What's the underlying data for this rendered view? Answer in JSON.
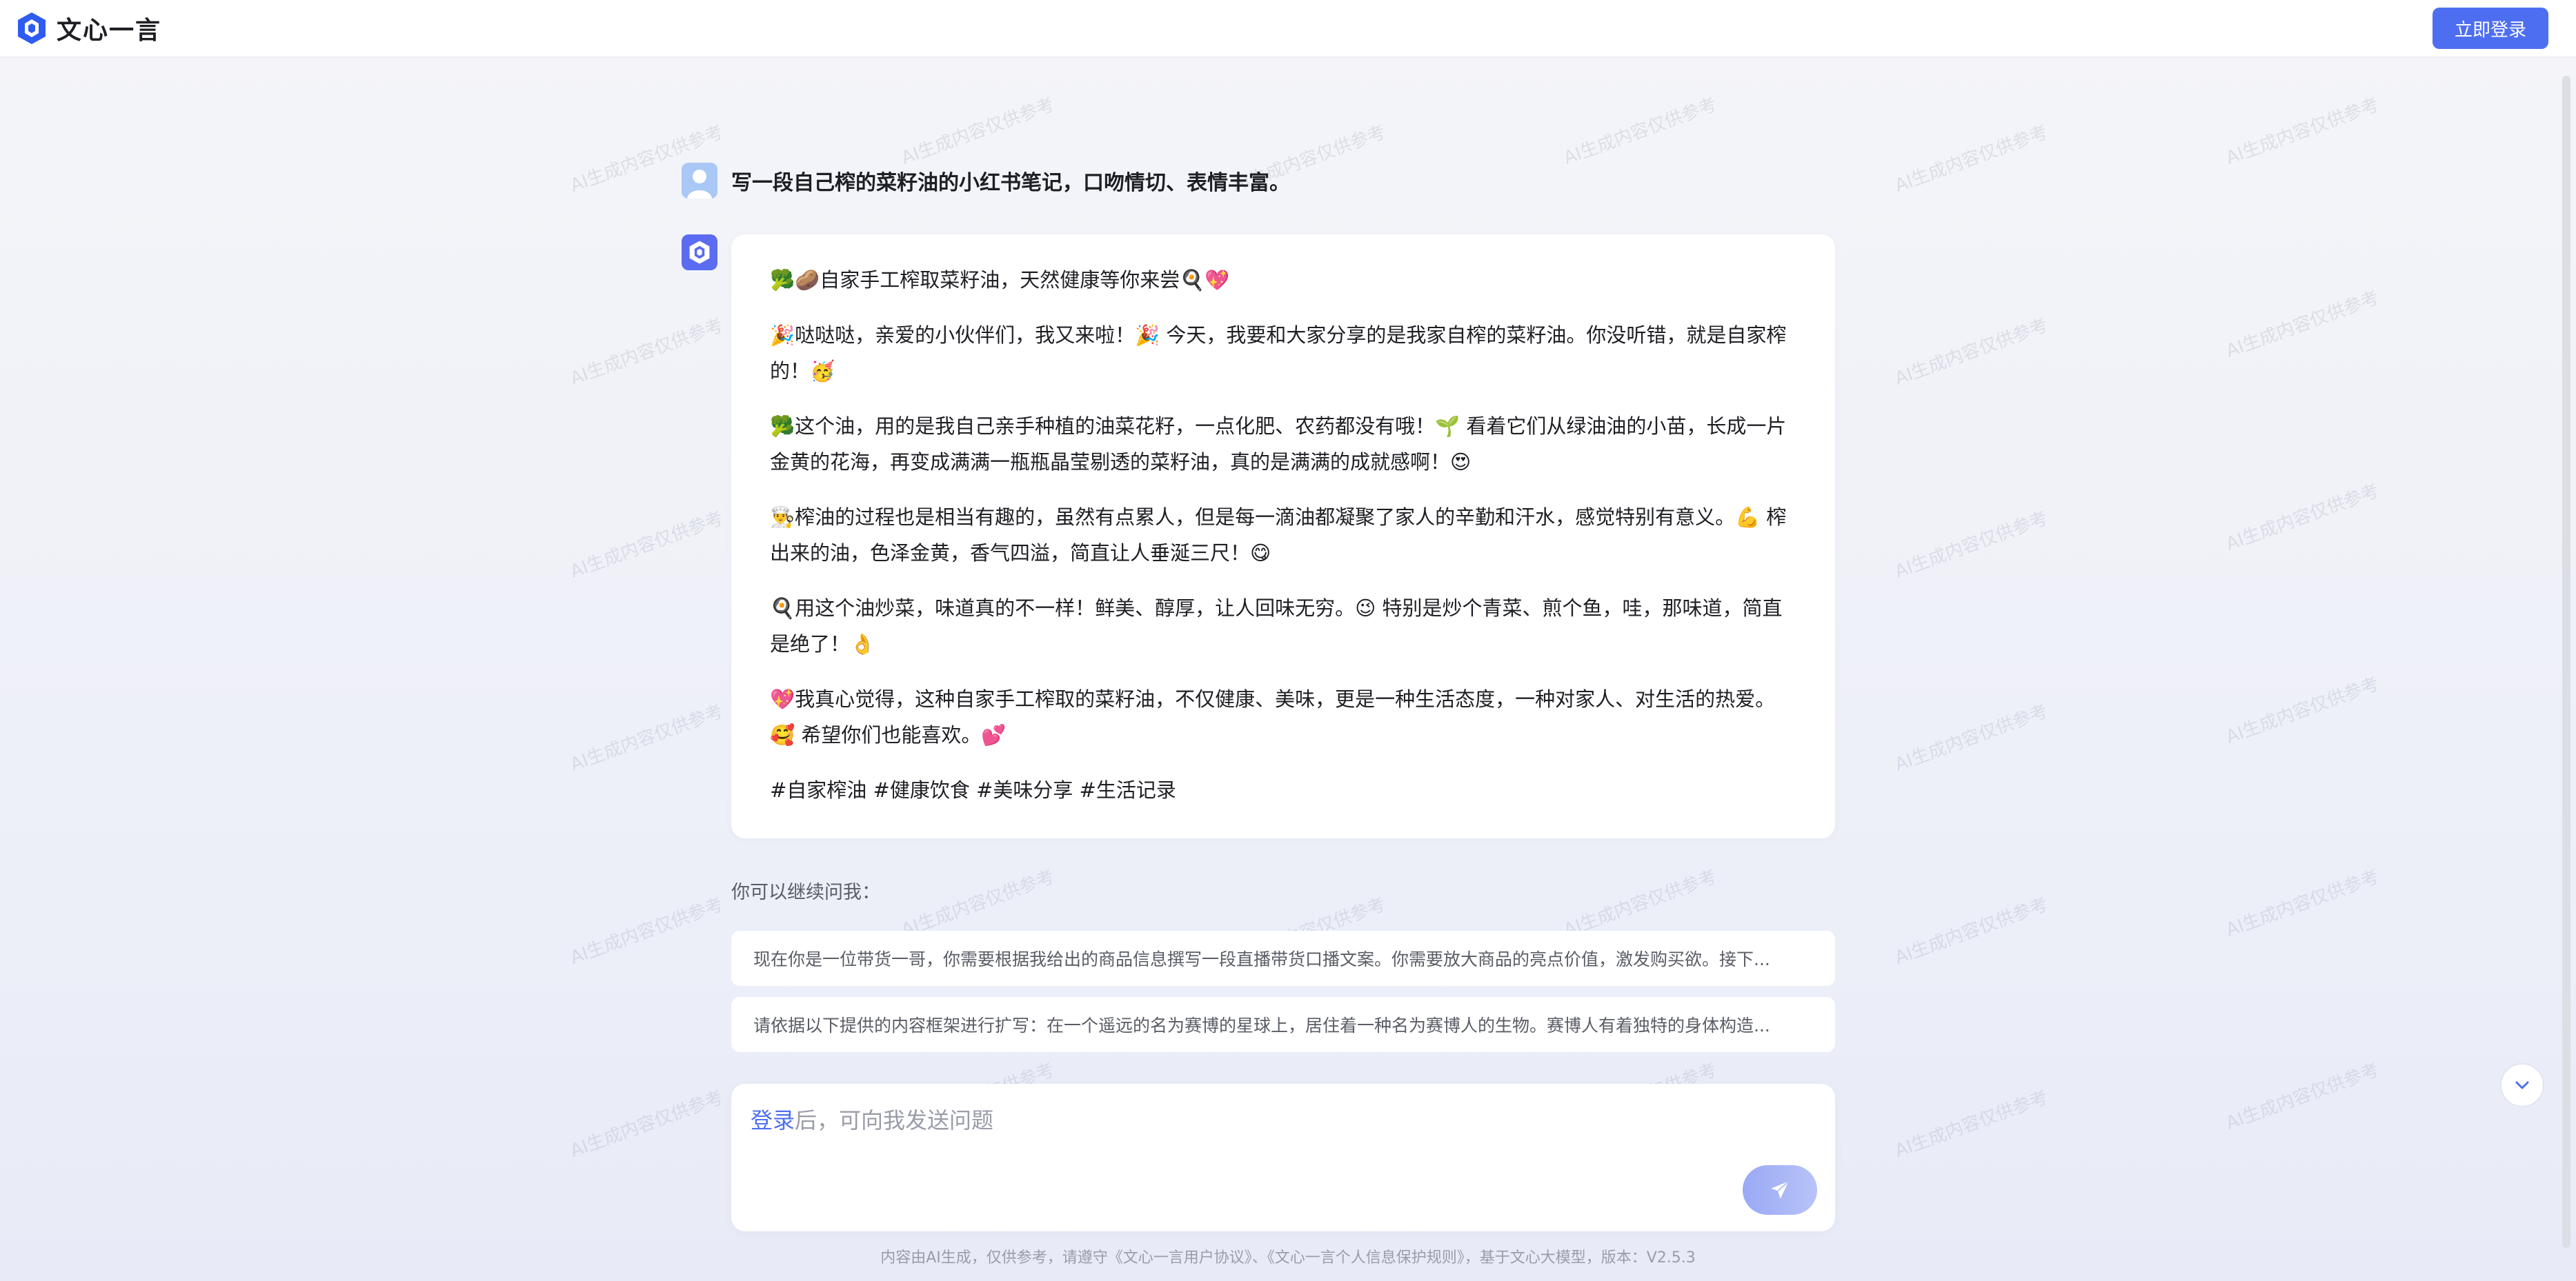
{
  "header": {
    "brand_name": "文心一言",
    "login_label": "立即登录"
  },
  "watermark": "AI生成内容仅供参考",
  "conversation": {
    "question": "写一段自己榨的菜籽油的小红书笔记，口吻情切、表情丰富。",
    "answer": [
      "🥦🥔自家手工榨取菜籽油，天然健康等你来尝🍳💖",
      "🎉哒哒哒，亲爱的小伙伴们，我又来啦！🎉 今天，我要和大家分享的是我家自榨的菜籽油。你没听错，就是自家榨的！🥳",
      "🥦这个油，用的是我自己亲手种植的油菜花籽，一点化肥、农药都没有哦！🌱 看着它们从绿油油的小苗，长成一片金黄的花海，再变成满满一瓶瓶晶莹剔透的菜籽油，真的是满满的成就感啊！😍",
      "👨‍🍳榨油的过程也是相当有趣的，虽然有点累人，但是每一滴油都凝聚了家人的辛勤和汗水，感觉特别有意义。💪 榨出来的油，色泽金黄，香气四溢，简直让人垂涎三尺！😋",
      "🍳用这个油炒菜，味道真的不一样！鲜美、醇厚，让人回味无穷。😉 特别是炒个青菜、煎个鱼，哇，那味道，简直是绝了！👌",
      "💖我真心觉得，这种自家手工榨取的菜籽油，不仅健康、美味，更是一种生活态度，一种对家人、对生活的热爱。🥰 希望你们也能喜欢。💕",
      "#自家榨油 #健康饮食 #美味分享 #生活记录"
    ]
  },
  "suggestions": {
    "hint": "你可以继续问我：",
    "items": [
      "现在你是一位带货一哥，你需要根据我给出的商品信息撰写一段直播带货口播文案。你需要放大商品的亮点价值，激发购买欲。接下...",
      "请依据以下提供的内容框架进行扩写：在一个遥远的名为赛博的星球上，居住着一种名为赛博人的生物。赛博人有着独特的身体构造..."
    ]
  },
  "composer": {
    "login_link": "登录",
    "placeholder_rest": "后，可向我发送问题"
  },
  "footer": "内容由AI生成，仅供参考，请遵守《文心一言用户协议》、《文心一言个人信息保护规则》，基于文心大模型，版本：V2.5.3",
  "colors": {
    "accent": "#4e6ef2",
    "background": "#f1f2f8"
  }
}
